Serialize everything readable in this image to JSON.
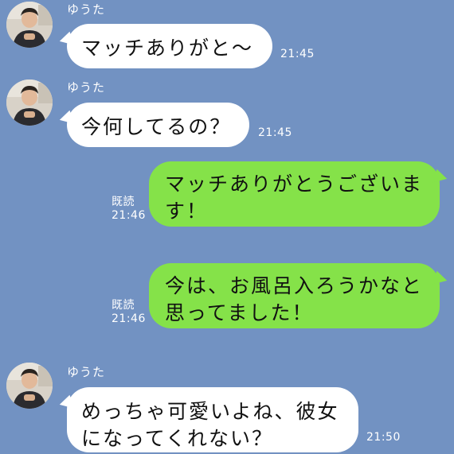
{
  "colors": {
    "background": "#7292c2",
    "incoming_bubble": "#ffffff",
    "outgoing_bubble": "#85e249",
    "meta_text": "#ffffff"
  },
  "messages": [
    {
      "direction": "incoming",
      "sender": "ゆうた",
      "text": "マッチありがと〜",
      "time": "21:45"
    },
    {
      "direction": "incoming",
      "sender": "ゆうた",
      "text": "今何してるの？",
      "time": "21:45"
    },
    {
      "direction": "outgoing",
      "read": "既読",
      "text": "マッチありがとうございま\nす！",
      "time": "21:46"
    },
    {
      "direction": "outgoing",
      "read": "既読",
      "text": "今は、お風呂入ろうかなと\n思ってました！",
      "time": "21:46"
    },
    {
      "direction": "incoming",
      "sender": "ゆうた",
      "text": "めっちゃ可愛いよね、彼女\nになってくれない？",
      "time": "21:50"
    }
  ]
}
